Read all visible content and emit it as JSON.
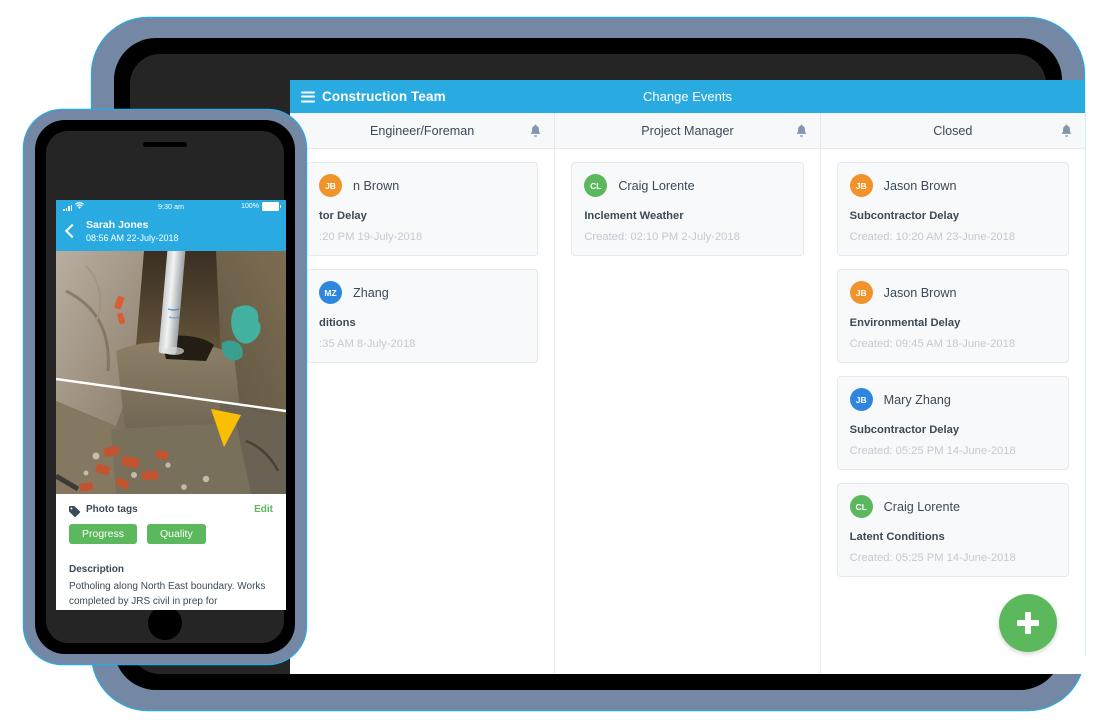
{
  "tablet": {
    "header": {
      "menu_icon": "hamburger-icon",
      "title": "Construction Team",
      "center_title": "Change Events"
    },
    "columns": [
      {
        "title": "Engineer/Foreman",
        "bell_icon": "bell-icon",
        "cards": [
          {
            "initials": "JB",
            "avatar_color": "#f0932b",
            "name": "n Brown",
            "type": "tor Delay",
            "created": ":20 PM 19-July-2018"
          },
          {
            "initials": "MZ",
            "avatar_color": "#2e86de",
            "name": " Zhang",
            "type": "ditions",
            "created": ":35 AM 8-July-2018"
          }
        ]
      },
      {
        "title": "Project Manager",
        "bell_icon": "bell-icon",
        "cards": [
          {
            "initials": "CL",
            "avatar_color": "#5cb85c",
            "name": "Craig Lorente",
            "type": "Inclement Weather",
            "created": "Created: 02:10 PM 2-July-2018"
          }
        ]
      },
      {
        "title": "Closed",
        "bell_icon": "bell-icon",
        "cards": [
          {
            "initials": "JB",
            "avatar_color": "#f0932b",
            "name": "Jason Brown",
            "type": "Subcontractor Delay",
            "created": "Created: 10:20 AM 23-June-2018"
          },
          {
            "initials": "JB",
            "avatar_color": "#f0932b",
            "name": "Jason Brown",
            "type": "Environmental Delay",
            "created": "Created: 09:45 AM 18-June-2018"
          },
          {
            "initials": "JB",
            "avatar_color": "#2e86de",
            "name": "Mary Zhang",
            "type": "Subcontractor Delay",
            "created": "Created: 05:25 PM 14-June-2018"
          },
          {
            "initials": "CL",
            "avatar_color": "#5cb85c",
            "name": "Craig Lorente",
            "type": "Latent Conditions",
            "created": "Created: 05:25 PM 14-June-2018"
          }
        ]
      }
    ],
    "fab": {
      "icon": "plus-icon",
      "label": "+"
    }
  },
  "phone": {
    "status_bar": {
      "time": "9:30 am",
      "battery_percent": "100%",
      "signal_icon": "signal-bars-icon",
      "wifi_icon": "wifi-icon",
      "battery_icon": "battery-full-icon"
    },
    "nav": {
      "back_icon": "back-chevron-icon",
      "name": "Sarah Jones",
      "date": "08:56 AM 22-July-2018"
    },
    "photo": {
      "alt": "excavation-trench-photo"
    },
    "tags": {
      "icon": "tag-icon",
      "label": "Photo tags",
      "edit_label": "Edit",
      "chips": [
        "Progress",
        "Quality"
      ]
    },
    "description": {
      "label": "Description",
      "text": "Potholing along North East boundary. Works completed by JRS civil in prep for"
    }
  },
  "colors": {
    "accent_blue": "#29abe2",
    "green": "#5cb85c",
    "orange": "#f0932b",
    "blue_avatar": "#2e86de",
    "text_dark": "#3b4a57",
    "muted": "#c2cad2"
  }
}
